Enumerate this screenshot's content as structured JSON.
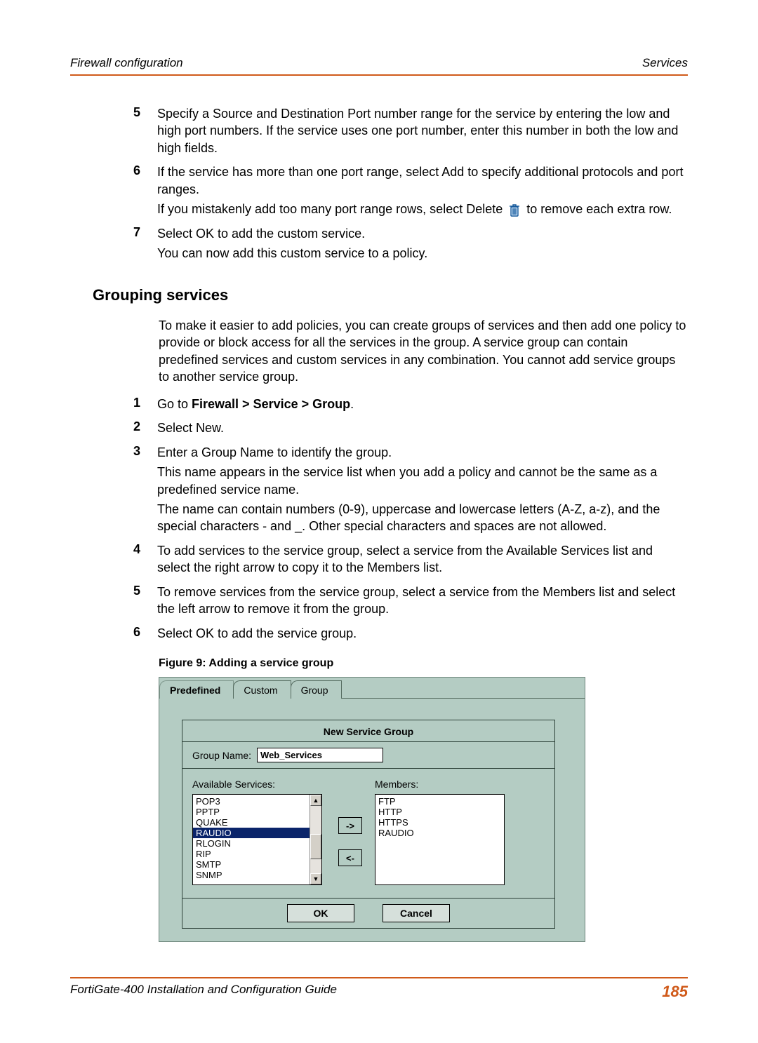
{
  "header": {
    "left": "Firewall configuration",
    "right": "Services"
  },
  "steps_top": [
    {
      "num": "5",
      "lines": [
        "Specify a Source and Destination Port number range for the service by entering the low and high port numbers. If the service uses one port number, enter this number in both the low and high fields."
      ]
    },
    {
      "num": "6",
      "lines": [
        "If the service has more than one port range, select Add to specify additional protocols and port ranges.",
        {
          "pre": "If you mistakenly add too many port range rows, select Delete ",
          "post": " to remove each extra row."
        }
      ]
    },
    {
      "num": "7",
      "lines": [
        "Select OK to add the custom service.",
        "You can now add this custom service to a policy."
      ]
    }
  ],
  "section_title": "Grouping services",
  "intro": "To make it easier to add policies, you can create groups of services and then add one policy to provide or block access for all the services in the group. A service group can contain predefined services and custom services in any combination. You cannot add service groups to another service group.",
  "steps_bottom": [
    {
      "num": "1",
      "lines": [
        {
          "pre": "Go to ",
          "bold": "Firewall > Service > Group",
          "post": "."
        }
      ]
    },
    {
      "num": "2",
      "lines": [
        "Select New."
      ]
    },
    {
      "num": "3",
      "lines": [
        "Enter a Group Name to identify the group.",
        "This name appears in the service list when you add a policy and cannot be the same as a predefined service name.",
        "The name can contain numbers (0-9), uppercase and lowercase letters (A-Z, a-z), and the special characters - and _. Other special characters and spaces are not allowed."
      ]
    },
    {
      "num": "4",
      "lines": [
        "To add services to the service group, select a service from the Available Services list and select the right arrow to copy it to the Members list."
      ]
    },
    {
      "num": "5",
      "lines": [
        "To remove services from the service group, select a service from the Members list and select the left arrow to remove it from the group."
      ]
    },
    {
      "num": "6",
      "lines": [
        "Select OK to add the service group."
      ]
    }
  ],
  "figure": {
    "caption": "Figure 9:   Adding a service group",
    "tabs": {
      "predef": "Predefined",
      "custom": "Custom",
      "group": "Group"
    },
    "panel_title": "New Service Group",
    "group_name_label": "Group Name:",
    "group_name_value": "Web_Services",
    "avail_label": "Available Services:",
    "members_label": "Members:",
    "available": [
      "POP3",
      "PPTP",
      "QUAKE",
      "RAUDIO",
      "RLOGIN",
      "RIP",
      "SMTP",
      "SNMP"
    ],
    "selected_index": 3,
    "members": [
      "FTP",
      "HTTP",
      "HTTPS",
      "RAUDIO"
    ],
    "arrow_right": "->",
    "arrow_left": "<-",
    "ok": "OK",
    "cancel": "Cancel"
  },
  "footer": {
    "left": "FortiGate-400 Installation and Configuration Guide",
    "page": "185"
  }
}
